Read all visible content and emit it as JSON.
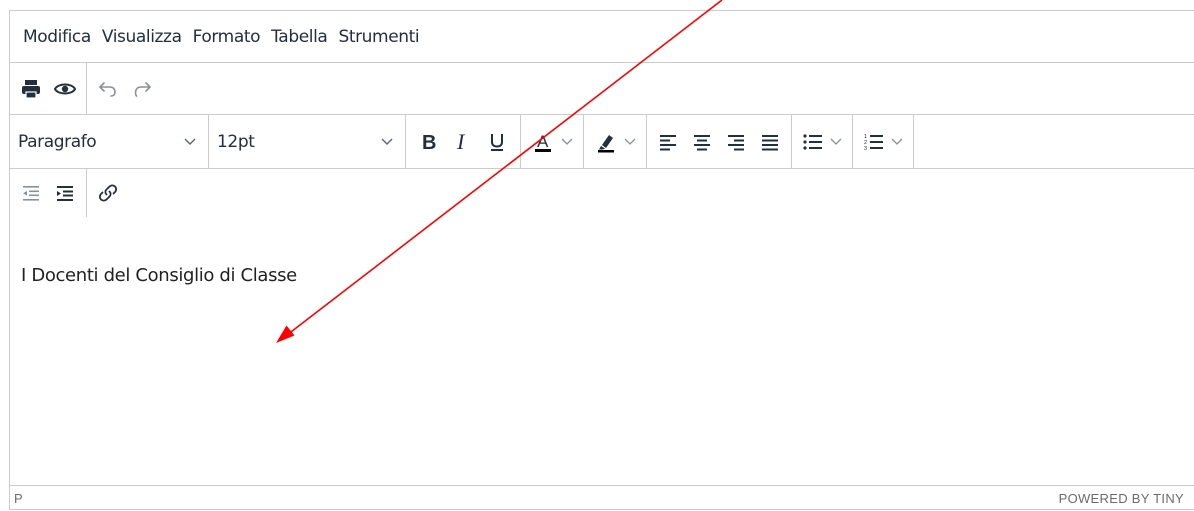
{
  "menubar": {
    "items": [
      {
        "label": "Modifica"
      },
      {
        "label": "Visualizza"
      },
      {
        "label": "Formato"
      },
      {
        "label": "Tabella"
      },
      {
        "label": "Strumenti"
      }
    ]
  },
  "toolbar": {
    "block_format": "Paragrafo",
    "font_size": "12pt",
    "icons": [
      "print-icon",
      "preview-icon",
      "undo-icon",
      "redo-icon",
      "bold-icon",
      "italic-icon",
      "underline-icon",
      "text-color-icon",
      "highlight-icon",
      "align-left-icon",
      "align-center-icon",
      "align-right-icon",
      "align-justify-icon",
      "bullet-list-icon",
      "numbered-list-icon",
      "outdent-icon",
      "indent-icon",
      "link-icon"
    ],
    "text_color": "#000000"
  },
  "content": {
    "paragraph": "I Docenti del Consiglio di Classe"
  },
  "statusbar": {
    "path": "P",
    "branding": "POWERED BY TINY"
  },
  "annotation": {
    "color": "#ff0000"
  }
}
